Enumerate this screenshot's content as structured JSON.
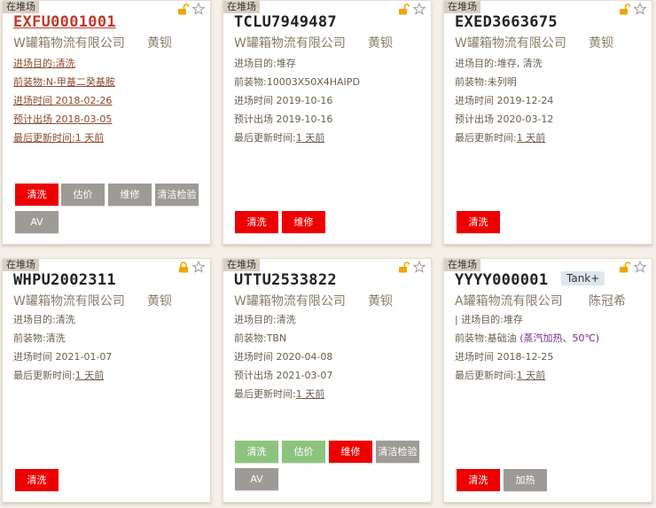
{
  "colors": {
    "accent_red": "#ee0000",
    "gray_button": "#9e9a96",
    "green_button": "#8cc47e",
    "badge_bg": "#d8cfc3"
  },
  "cards": [
    {
      "status": "在堆场",
      "container": "EXFU0001001",
      "company": "W罐箱物流有限公司",
      "person": "黄钡",
      "purpose": "进场目的:清洗",
      "last_cargo": "前装物:N-甲基二癸基胺",
      "entry": "进场时间 2018-02-26",
      "exit": "预计出场 2018-03-05",
      "updated_label": "最后更新时间:",
      "updated_value": "1 天前",
      "buttons": [
        "清洗",
        "估价",
        "维修",
        "清洁检验",
        "AV"
      ]
    },
    {
      "status": "在堆场",
      "container": "TCLU7949487",
      "company": "W罐箱物流有限公司",
      "person": "黄钡",
      "purpose": "进场目的:堆存",
      "last_cargo": "前装物:10003X50X4HAIPD",
      "entry": "进场时间 2019-10-16",
      "exit": "预计出场 2019-10-16",
      "updated_label": "最后更新时间:",
      "updated_value": "1 天前",
      "buttons": [
        "清洗",
        "维修"
      ]
    },
    {
      "status": "在堆场",
      "container": "EXED3663675",
      "company": "W罐箱物流有限公司",
      "person": "黄钡",
      "purpose": "进场目的:堆存, 清洗",
      "last_cargo": "前装物:未列明",
      "entry": "进场时间 2019-12-24",
      "exit": "预计出场 2020-03-12",
      "updated_label": "最后更新时间:",
      "updated_value": "1 天前",
      "buttons": [
        "清洗"
      ]
    },
    {
      "status": "在堆场",
      "container": "WHPU2002311",
      "company": "W罐箱物流有限公司",
      "person": "黄钡",
      "purpose": "进场目的:清洗",
      "last_cargo": "前装物:清洗",
      "entry": "进场时间 2021-01-07",
      "updated_label": "最后更新时间:",
      "updated_value": "1 天前",
      "buttons": [
        "清洗"
      ]
    },
    {
      "status": "在堆场",
      "container": "UTTU2533822",
      "company": "W罐箱物流有限公司",
      "person": "黄钡",
      "purpose": "进场目的:清洗",
      "last_cargo": "前装物:TBN",
      "entry": "进场时间 2020-04-08",
      "exit": "预计出场 2021-03-07",
      "updated_label": "最后更新时间:",
      "updated_value": "1 天前",
      "buttons": [
        "清洗",
        "估价",
        "维修",
        "清洁检验",
        "AV"
      ]
    },
    {
      "status": "在堆场",
      "container": "YYYY000001",
      "tag": "Tank+",
      "company": "A罐箱物流有限公司",
      "person": "陈冠希",
      "purpose": "| 进场目的:堆存",
      "last_cargo": "前装物:基础油",
      "cargo_note": "(蒸汽加热、50℃)",
      "entry": "进场时间 2018-12-25",
      "updated_label": "最后更新时间:",
      "updated_value": "1 天前",
      "buttons": [
        "清洗",
        "加热"
      ]
    }
  ]
}
